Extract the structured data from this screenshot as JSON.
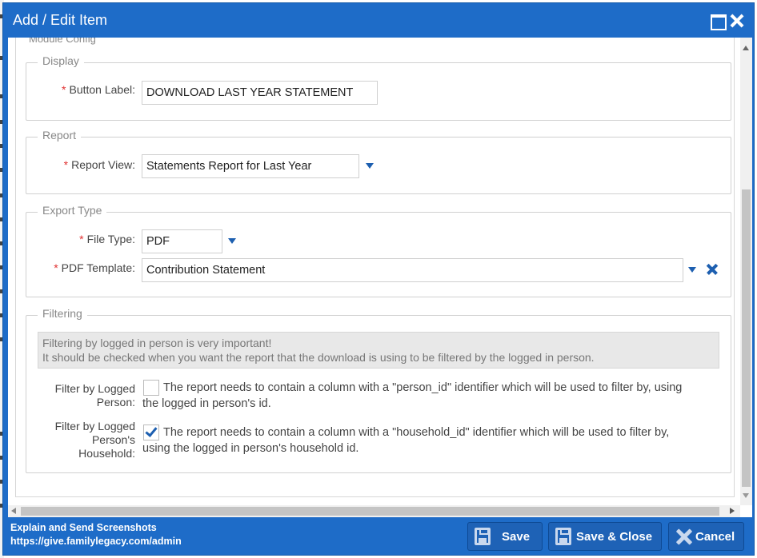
{
  "dialog": {
    "title": "Add / Edit Item"
  },
  "cut_section": {
    "legend": "Module Config"
  },
  "display": {
    "legend": "Display",
    "button_label": {
      "label": "Button Label:",
      "value": "DOWNLOAD LAST YEAR STATEMENT"
    }
  },
  "report": {
    "legend": "Report",
    "report_view": {
      "label": "Report View:",
      "value": "Statements Report for Last Year"
    }
  },
  "export_type": {
    "legend": "Export Type",
    "file_type": {
      "label": "File Type:",
      "value": "PDF"
    },
    "pdf_template": {
      "label": "PDF Template:",
      "value": "Contribution Statement"
    }
  },
  "filtering": {
    "legend": "Filtering",
    "notice_line1": "Filtering by logged in person is very important!",
    "notice_line2": "It should be checked when you want the report that the download is using to be filtered by the logged in person.",
    "person": {
      "label_line1": "Filter by Logged",
      "label_line2": "Person:",
      "checked": false,
      "text_line1": "The report needs to contain a column with a \"person_id\" identifier which will be used to filter by, using",
      "text_line2": "the logged in person's id."
    },
    "household": {
      "label_line1": "Filter by Logged",
      "label_line2": "Person's",
      "label_line3": "Household:",
      "checked": true,
      "text_line1": "The report needs to contain a column with a \"household_id\" identifier which will be used to filter by,",
      "text_line2": "using the logged in person's household id."
    }
  },
  "footer": {
    "line1": "Explain and Send Screenshots",
    "line2": "https://give.familylegacy.com/admin",
    "save_label": "Save",
    "save_close_label": "Save & Close",
    "cancel_label": "Cancel"
  },
  "required_marker": "*",
  "colors": {
    "accent": "#1e6cc8",
    "required": "#e03030",
    "icon_blue": "#1d5fb0"
  },
  "icons": [
    "maximize-icon",
    "close-icon",
    "dropdown-caret-icon",
    "clear-x-icon",
    "checkmark-icon",
    "floppy-disk-icon",
    "cancel-x-icon"
  ]
}
